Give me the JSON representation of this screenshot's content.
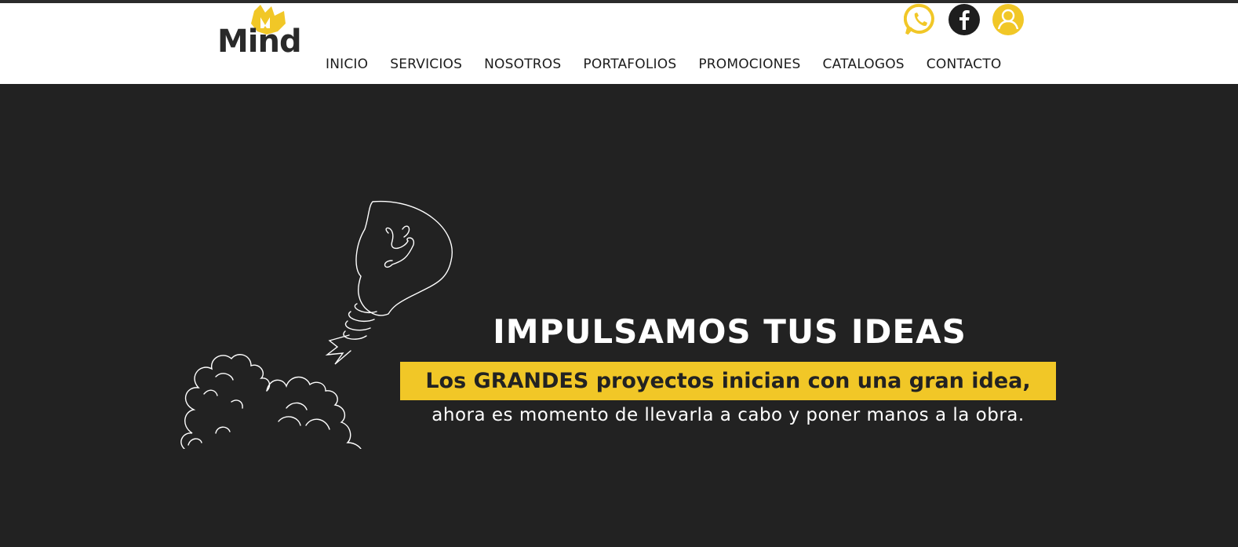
{
  "brand": {
    "logo_text": "Mind",
    "accent": "#f1c727",
    "dark": "#222222"
  },
  "nav": {
    "items": [
      {
        "label": "INICIO"
      },
      {
        "label": "SERVICIOS"
      },
      {
        "label": "NOSOTROS"
      },
      {
        "label": "PORTAFOLIOS"
      },
      {
        "label": "PROMOCIONES"
      },
      {
        "label": "CATALOGOS"
      },
      {
        "label": "CONTACTO"
      }
    ]
  },
  "socials": {
    "items": [
      "whatsapp-icon",
      "facebook-icon",
      "user-icon"
    ]
  },
  "hero": {
    "title": "IMPULSAMOS TUS IDEAS",
    "highlight": "Los GRANDES proyectos inician con una gran idea,",
    "subtitle": "ahora es momento de llevarla a cabo y poner manos a la obra."
  }
}
